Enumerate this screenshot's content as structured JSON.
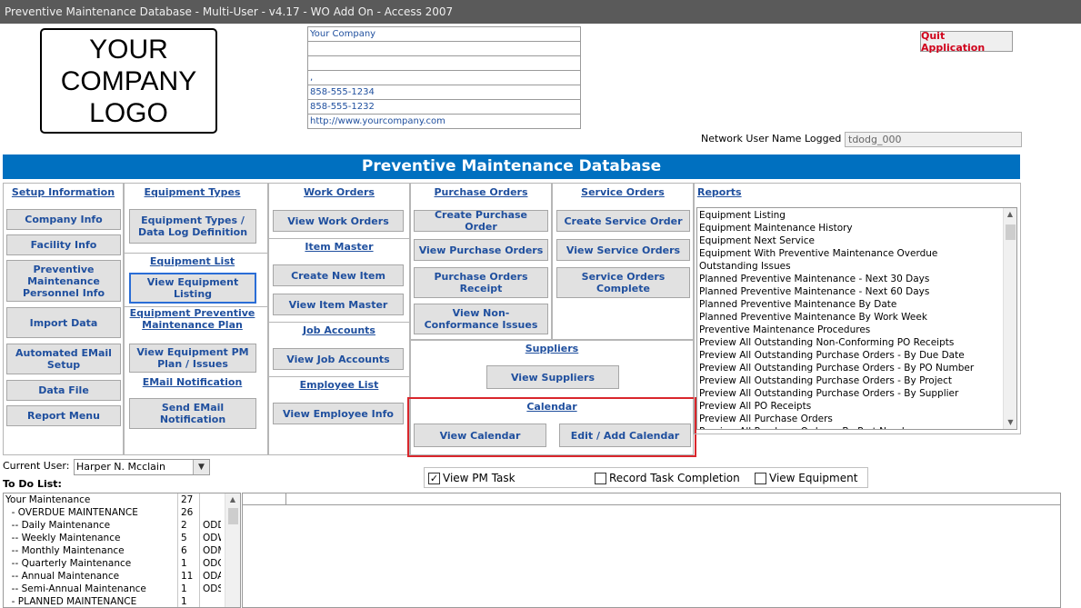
{
  "window": {
    "title": "Preventive Maintenance Database - Multi-User - v4.17 - WO Add On - Access 2007"
  },
  "logo": {
    "text": "YOUR\nCOMPANY\nLOGO"
  },
  "company": {
    "rows": [
      "Your Company",
      "",
      "",
      ",",
      "858-555-1234",
      "858-555-1232",
      "http://www.yourcompany.com"
    ]
  },
  "quit_label": "Quit Application",
  "network": {
    "label": "Network User Name Logged in is",
    "value": "tdodg_000"
  },
  "banner": "Preventive Maintenance Database",
  "setup": {
    "header": "Setup Information",
    "buttons": [
      "Company Info",
      "Facility Info",
      "Preventive Maintenance Personnel Info",
      "Import Data",
      "Automated EMail Setup",
      "Data File",
      "Report Menu"
    ]
  },
  "equipment_types": {
    "header": "Equipment Types",
    "button": "Equipment Types / Data Log Definition"
  },
  "equipment_list": {
    "header": "Equipment List",
    "button": "View Equipment Listing"
  },
  "equipment_pm": {
    "header": "Equipment Preventive Maintenance Plan",
    "button": "View Equipment PM Plan / Issues"
  },
  "email_notify": {
    "header": "EMail Notification",
    "button": "Send EMail Notification"
  },
  "work_orders": {
    "header": "Work Orders",
    "button": "View Work Orders"
  },
  "item_master": {
    "header": "Item Master",
    "create": "Create New Item",
    "view": "View Item Master"
  },
  "job_accounts": {
    "header": "Job Accounts",
    "button": "View Job Accounts"
  },
  "employee_list": {
    "header": "Employee List",
    "button": "View Employee Info"
  },
  "purchase_orders": {
    "header": "Purchase Orders",
    "create": "Create Purchase Order",
    "view": "View Purchase Orders",
    "receipt": "Purchase Orders Receipt",
    "nonconf": "View Non-Conformance Issues"
  },
  "service_orders": {
    "header": "Service Orders",
    "create": "Create Service Order",
    "view": "View Service Orders",
    "complete": "Service Orders Complete"
  },
  "suppliers": {
    "header": "Suppliers",
    "button": "View Suppliers"
  },
  "calendar": {
    "header": "Calendar",
    "view": "View Calendar",
    "edit": "Edit / Add Calendar"
  },
  "reports": {
    "header": "Reports",
    "items": [
      "Equipment Listing",
      "Equipment Maintenance History",
      "Equipment Next Service",
      "Equipment With Preventive Maintenance Overdue",
      "Outstanding Issues",
      "Planned Preventive Maintenance - Next 30 Days",
      "Planned Preventive Maintenance - Next 60 Days",
      "Planned Preventive Maintenance By Date",
      "Planned Preventive Maintenance By Work Week",
      "Preventive Maintenance Procedures",
      "Preview All Outstanding Non-Conforming PO Receipts",
      "Preview All Outstanding Purchase Orders - By Due Date",
      "Preview All Outstanding Purchase Orders - By PO Number",
      "Preview All Outstanding Purchase Orders - By Project",
      "Preview All Outstanding Purchase Orders - By Supplier",
      "Preview All PO Receipts",
      "Preview All Purchase Orders",
      "Preview All Purchase Orders - By Part Number"
    ]
  },
  "current_user": {
    "label": "Current User:",
    "value": "Harper N. Mcclain"
  },
  "todo": {
    "label": "To Do List:",
    "rows": [
      {
        "name": "Your Maintenance",
        "count": "27",
        "code": ""
      },
      {
        "name": "  - OVERDUE MAINTENANCE",
        "count": "26",
        "code": ""
      },
      {
        "name": "  -- Daily Maintenance",
        "count": "2",
        "code": "ODD"
      },
      {
        "name": "  -- Weekly Maintenance",
        "count": "5",
        "code": "ODW"
      },
      {
        "name": "  -- Monthly Maintenance",
        "count": "6",
        "code": "ODM"
      },
      {
        "name": "  -- Quarterly Maintenance",
        "count": "1",
        "code": "ODQ"
      },
      {
        "name": "  -- Annual Maintenance",
        "count": "11",
        "code": "ODA"
      },
      {
        "name": "  -- Semi-Annual Maintenance",
        "count": "1",
        "code": "ODS"
      },
      {
        "name": "  - PLANNED MAINTENANCE",
        "count": "1",
        "code": ""
      }
    ]
  },
  "tasks": {
    "view_pm": {
      "label": "View PM Task",
      "checked": "☑"
    },
    "record": {
      "label": "Record Task Completion",
      "checked": ""
    },
    "view_equipment": {
      "label": "View Equipment",
      "checked": ""
    }
  },
  "icons": {
    "scroll_up": "▲",
    "scroll_down": "▼",
    "dropdown": "▼",
    "checkmark": "✓"
  }
}
